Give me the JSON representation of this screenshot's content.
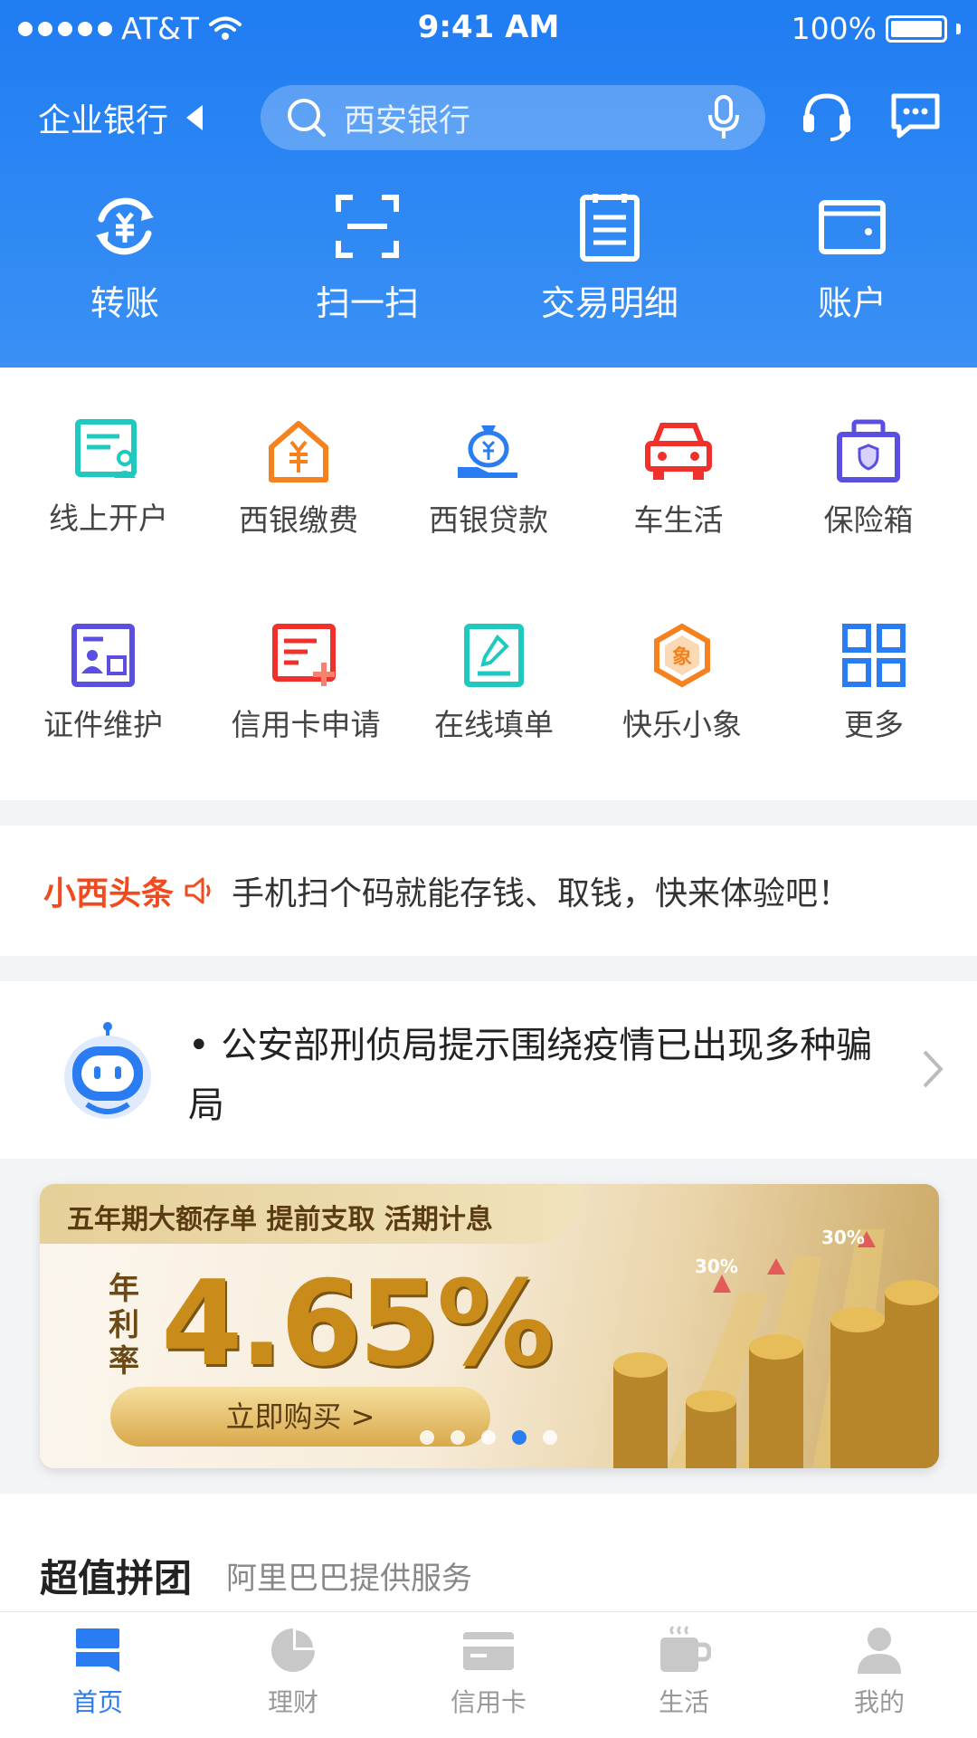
{
  "status_bar": {
    "carrier": "AT&T",
    "time": "9:41 AM",
    "battery": "100%"
  },
  "header": {
    "account_type": "企业银行",
    "search_placeholder": "西安银行",
    "quick_actions": [
      {
        "label": "转账",
        "icon": "transfer-icon"
      },
      {
        "label": "扫一扫",
        "icon": "scan-icon"
      },
      {
        "label": "交易明细",
        "icon": "transaction-details-icon"
      },
      {
        "label": "账户",
        "icon": "wallet-icon"
      }
    ]
  },
  "services": [
    {
      "label": "线上开户",
      "icon": "online-account-icon",
      "color": "#1ec9c0"
    },
    {
      "label": "西银缴费",
      "icon": "payment-house-icon",
      "color": "#f5821f"
    },
    {
      "label": "西银贷款",
      "icon": "loan-bag-icon",
      "color": "#2a7cf2"
    },
    {
      "label": "车生活",
      "icon": "car-icon",
      "color": "#f0302a"
    },
    {
      "label": "保险箱",
      "icon": "safe-box-icon",
      "color": "#5a4fe0"
    },
    {
      "label": "证件维护",
      "icon": "id-card-icon",
      "color": "#5a4fe0"
    },
    {
      "label": "信用卡申请",
      "icon": "credit-apply-icon",
      "color": "#f0302a"
    },
    {
      "label": "在线填单",
      "icon": "online-form-icon",
      "color": "#1ec9c0"
    },
    {
      "label": "快乐小象",
      "icon": "elephant-hexagon-icon",
      "color": "#f5821f"
    },
    {
      "label": "更多",
      "icon": "more-grid-icon",
      "color": "#2a7cf2"
    }
  ],
  "ticker": {
    "title": "小西头条",
    "text": "手机扫个码就能存钱、取钱，快来体验吧！"
  },
  "notice": {
    "text": "• 公安部刑侦局提示围绕疫情已出现多种骗局"
  },
  "banner": {
    "headline": "五年期大额存单  提前支取 活期计息",
    "rate_label": "年利率",
    "rate": "4.65%",
    "button": "立即购买 >",
    "chart_labels": [
      "30%",
      "30%"
    ],
    "page_count": 5,
    "active_page": 3
  },
  "group_buy": {
    "title": "超值拼团",
    "subtitle": "阿里巴巴提供服务"
  },
  "tabbar": [
    {
      "label": "首页",
      "icon": "home-icon",
      "active": true
    },
    {
      "label": "理财",
      "icon": "pie-chart-icon",
      "active": false
    },
    {
      "label": "信用卡",
      "icon": "credit-card-icon",
      "active": false
    },
    {
      "label": "生活",
      "icon": "coffee-cup-icon",
      "active": false
    },
    {
      "label": "我的",
      "icon": "user-icon",
      "active": false
    }
  ],
  "colors": {
    "primary": "#2a7cf2",
    "accent_red": "#f04a1e",
    "gold": "#c98c1a"
  }
}
